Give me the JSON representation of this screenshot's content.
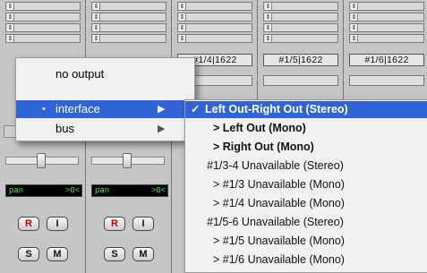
{
  "strips": [
    {
      "io_label": "",
      "pan_label": "pan",
      "pan_value": ">0<",
      "buttons": [
        "R",
        "I",
        "S",
        "M"
      ]
    },
    {
      "io_label": "",
      "pan_label": "pan",
      "pan_value": ">0<",
      "buttons": [
        "R",
        "I",
        "S",
        "M"
      ]
    },
    {
      "io_label": "#1/4|1622",
      "pan_label": "",
      "pan_value": "",
      "buttons": []
    },
    {
      "io_label": "#1/5|1622",
      "pan_label": "",
      "pan_value": "",
      "buttons": []
    },
    {
      "io_label": "#1/6|1622",
      "pan_label": "",
      "pan_value": "",
      "buttons": []
    }
  ],
  "output_menu": {
    "items": [
      {
        "label": "no output",
        "selected": false,
        "submenu": false
      },
      {
        "label": "interface",
        "selected": true,
        "submenu": true
      },
      {
        "label": "bus",
        "selected": false,
        "submenu": true
      }
    ]
  },
  "interface_submenu": {
    "items": [
      {
        "label": "Left Out-Right Out (Stereo)",
        "checked": true
      },
      {
        "label": "> Left Out (Mono)",
        "checked": false
      },
      {
        "label": "> Right Out (Mono)",
        "checked": false
      },
      {
        "label": "#1/3-4 Unavailable (Stereo)",
        "checked": false
      },
      {
        "label": "> #1/3 Unavailable (Mono)",
        "checked": false
      },
      {
        "label": "> #1/4 Unavailable (Mono)",
        "checked": false
      },
      {
        "label": "#1/5-6 Unavailable (Stereo)",
        "checked": false
      },
      {
        "label": "> #1/5 Unavailable (Mono)",
        "checked": false
      },
      {
        "label": "> #1/6 Unavailable (Mono)",
        "checked": false
      }
    ]
  },
  "icons": {
    "check": "✓",
    "radio_dot": "•",
    "submenu_arrow": "▶",
    "insert_arrow": "⇕"
  },
  "colors": {
    "highlight": "#3064d6",
    "pan_text": "#3cff3c",
    "record": "#c00000"
  }
}
